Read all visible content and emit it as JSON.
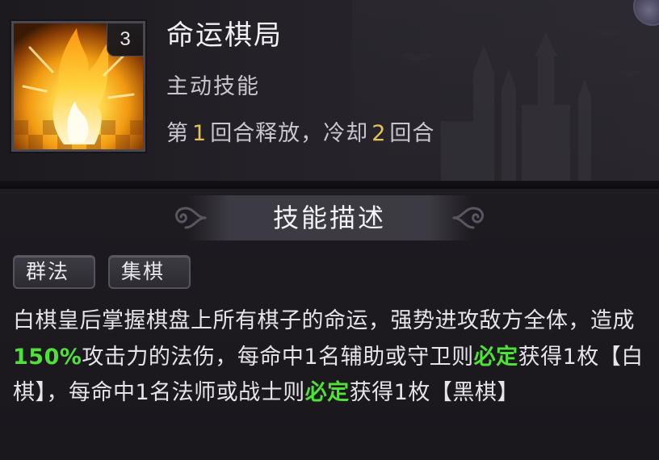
{
  "skill": {
    "name": "命运棋局",
    "level": "3",
    "type": "主动技能",
    "timing": {
      "prefix": "第",
      "release_round": "1",
      "middle": "回合释放，冷却",
      "cooldown_rounds": "2",
      "suffix": "回合"
    }
  },
  "description": {
    "section_title": "技能描述",
    "tags": [
      "群法",
      "集棋"
    ],
    "segments": [
      {
        "text": "白棋皇后掌握棋盘上所有棋子的命运，强势进攻敌方全体，造成",
        "style": "normal"
      },
      {
        "text": "150%",
        "style": "green"
      },
      {
        "text": "攻击力的法伤，每命中1名辅助或守卫则",
        "style": "normal"
      },
      {
        "text": "必定",
        "style": "green"
      },
      {
        "text": "获得1枚【白棋】，每命中1名法师或战士则",
        "style": "normal"
      },
      {
        "text": "必定",
        "style": "green"
      },
      {
        "text": "获得1枚【黑棋】",
        "style": "normal"
      }
    ]
  },
  "colors": {
    "highlight_green": "#4fe03a",
    "number_gold": "#e8c15a",
    "text_primary": "#e6e4ea",
    "panel_bg": "#1f1d22"
  },
  "icons": {
    "skill_icon": "golden-flame-chess-icon",
    "corner": "corner-orb-icon",
    "ornament": "scroll-ornament-icon"
  }
}
